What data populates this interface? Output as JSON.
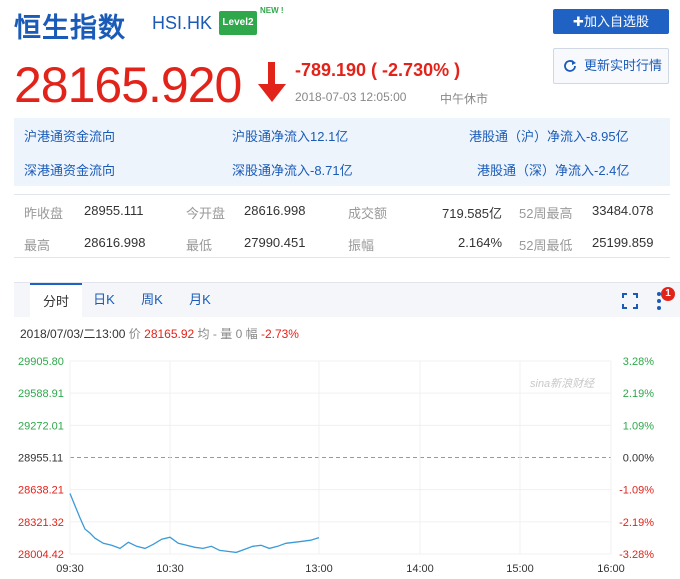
{
  "header": {
    "title": "恒生指数",
    "code": "HSI.HK",
    "level2": "Level2",
    "new_tag": "NEW !",
    "add_button": "✚加入自选股"
  },
  "quote": {
    "price": "28165.920",
    "change": "-789.190 ( -2.730% )",
    "time": "2018-07-03 12:05:00",
    "status": "中午休市",
    "refresh_label": "更新实时行情"
  },
  "flows": {
    "row1": [
      "沪港通资金流向",
      "沪股通净流入12.1亿",
      "港股通（沪）净流入-8.95亿"
    ],
    "row2": [
      "深港通资金流向",
      "深股通净流入-8.71亿",
      "港股通（深）净流入-2.4亿"
    ]
  },
  "stats": {
    "row1": [
      {
        "label": "昨收盘",
        "value": "28955.111"
      },
      {
        "label": "今开盘",
        "value": "28616.998"
      },
      {
        "label": "成交额",
        "value": "719.585亿"
      },
      {
        "label": "52周最高",
        "value": "33484.078"
      }
    ],
    "row2": [
      {
        "label": "最高",
        "value": "28616.998"
      },
      {
        "label": "最低",
        "value": "27990.451"
      },
      {
        "label": "振幅",
        "value": "2.164%"
      },
      {
        "label": "52周最低",
        "value": "25199.859"
      }
    ]
  },
  "chart_tabs": [
    "分时",
    "日K",
    "周K",
    "月K"
  ],
  "badge": "1",
  "info": {
    "datetime": "2018/07/03/二13:00",
    "price_label": "价",
    "price": "28165.92",
    "avg_label": "均 -",
    "vol_label": "量 0",
    "amp_label": "幅",
    "amp": "-2.73%"
  },
  "watermark": "sina新浪财经",
  "colors": {
    "up": "#2ea84b",
    "down": "#e2231a",
    "line": "#3b9bd8",
    "brand": "#1a5bb8"
  },
  "chart_data": {
    "type": "line",
    "ylim": [
      28004.42,
      29905.8
    ],
    "left_ticks": [
      "29905.80",
      "29588.91",
      "29272.01",
      "28955.11",
      "28638.21",
      "28321.32",
      "28004.42"
    ],
    "right_ticks": [
      "3.28%",
      "2.19%",
      "1.09%",
      "0.00%",
      "-1.09%",
      "-2.19%",
      "-3.28%"
    ],
    "baseline": 28955.11,
    "x_ticks": [
      "09:30",
      "10:30",
      "13:00",
      "14:00",
      "15:00",
      "16:00"
    ],
    "x": [
      "09:30",
      "09:33",
      "09:36",
      "09:39",
      "09:42",
      "09:45",
      "09:50",
      "09:55",
      "10:00",
      "10:05",
      "10:10",
      "10:15",
      "10:20",
      "10:25",
      "10:30",
      "10:35",
      "10:40",
      "10:45",
      "10:50",
      "10:55",
      "11:00",
      "11:05",
      "11:10",
      "11:15",
      "11:20",
      "11:25",
      "11:30",
      "11:35",
      "11:40",
      "11:45",
      "11:50",
      "11:55",
      "12:00"
    ],
    "values": [
      28600,
      28480,
      28360,
      28250,
      28210,
      28160,
      28110,
      28090,
      28060,
      28120,
      28080,
      28060,
      28100,
      28150,
      28170,
      28110,
      28090,
      28070,
      28060,
      28080,
      28040,
      28030,
      28020,
      28050,
      28080,
      28090,
      28060,
      28080,
      28110,
      28120,
      28130,
      28140,
      28166
    ]
  }
}
